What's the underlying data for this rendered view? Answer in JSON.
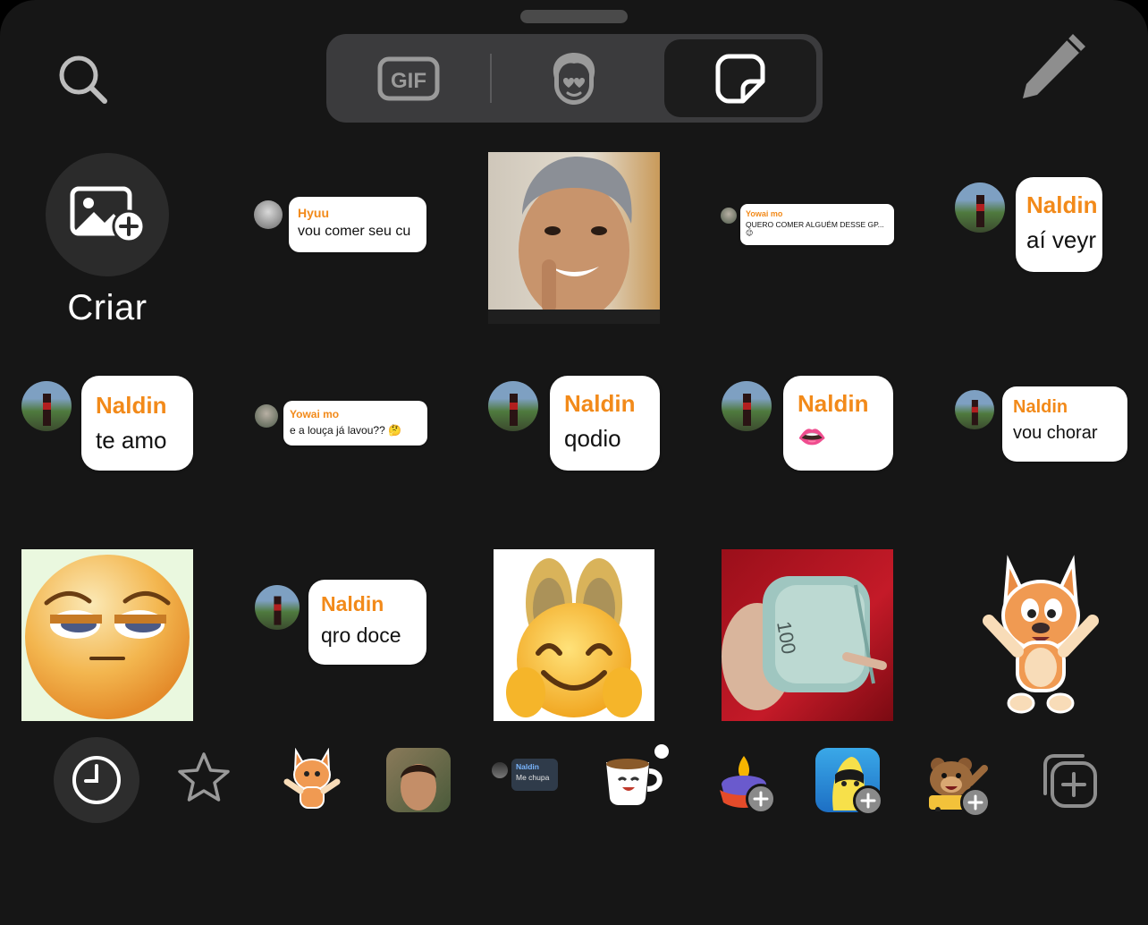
{
  "tabs": {
    "gif_label": "GIF",
    "active": "stickers"
  },
  "create": {
    "label": "Criar"
  },
  "stickers": [
    {
      "id": "s1",
      "name": "Hyuu",
      "message": "vou comer seu cu"
    },
    {
      "id": "s3",
      "name": "Yowai mo",
      "message": "QUERO COMER ALGUÉM DESSE GP...",
      "emoji": "😉"
    },
    {
      "id": "s4",
      "name": "Naldin",
      "message": "aí veyr"
    },
    {
      "id": "s5",
      "name": "Naldin",
      "message": "te amo"
    },
    {
      "id": "s6",
      "name": "Yowai mo",
      "message": "e a louça já lavou??",
      "emoji": "🤔"
    },
    {
      "id": "s7",
      "name": "Naldin",
      "message": "qodio"
    },
    {
      "id": "s8",
      "name": "Naldin",
      "message": "",
      "emoji": "👄"
    },
    {
      "id": "s9",
      "name": "Naldin",
      "message": "vou chorar"
    },
    {
      "id": "s10",
      "name": "Naldin",
      "message": "qro doce"
    }
  ],
  "tray": {
    "mini_sticker": {
      "name": "Naldin",
      "message": "Me chupa"
    }
  },
  "colors": {
    "background": "#161616",
    "bubble_name": "#f28a1a",
    "tab_bg": "#3b3b3d"
  }
}
